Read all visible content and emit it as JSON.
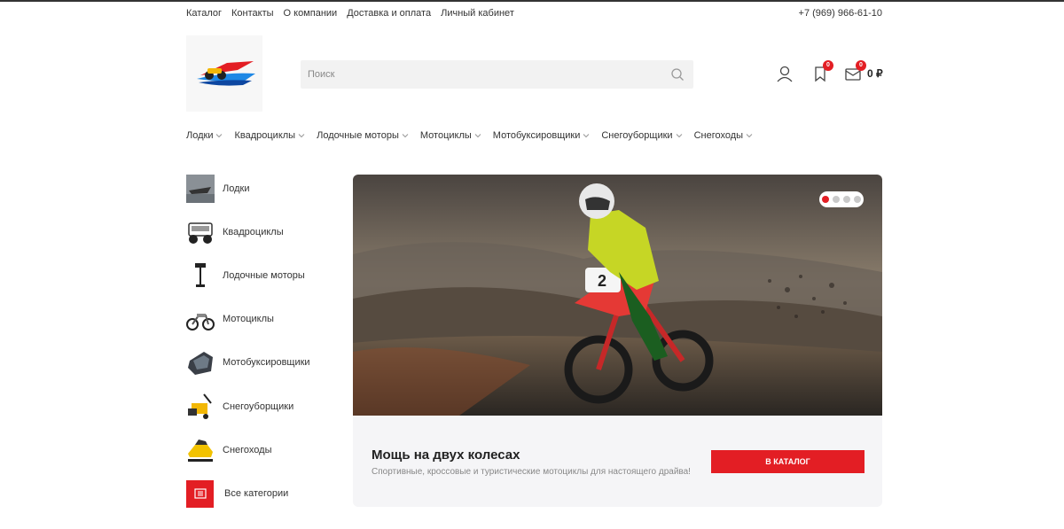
{
  "top_nav": [
    "Каталог",
    "Контакты",
    "О компании",
    "Доставка и оплата",
    "Личный кабинет"
  ],
  "phone": "+7 (969) 966-61-10",
  "search": {
    "placeholder": "Поиск"
  },
  "header": {
    "wishlist_count": "0",
    "cart_count": "0",
    "cart_total": "0 ₽"
  },
  "category_nav": [
    "Лодки",
    "Квадроциклы",
    "Лодочные моторы",
    "Мотоциклы",
    "Мотобуксировщики",
    "Снегоуборщики",
    "Снегоходы"
  ],
  "sidebar": {
    "items": [
      {
        "label": "Лодки",
        "icon": "boat-icon"
      },
      {
        "label": "Квадроциклы",
        "icon": "atv-icon"
      },
      {
        "label": "Лодочные моторы",
        "icon": "outboard-motor-icon"
      },
      {
        "label": "Мотоциклы",
        "icon": "motorcycle-icon"
      },
      {
        "label": "Мотобуксировщики",
        "icon": "motor-tug-icon"
      },
      {
        "label": "Снегоуборщики",
        "icon": "snowblower-icon"
      },
      {
        "label": "Снегоходы",
        "icon": "snowmobile-icon"
      }
    ],
    "all_label": "Все категории"
  },
  "slider": {
    "slides": 4,
    "active": 1
  },
  "promo": {
    "title": "Мощь на двух колесах",
    "subtitle": "Спортивные, кроссовые и туристические мотоциклы для настоящего драйва!",
    "button": "В КАТАЛОГ"
  },
  "colors": {
    "accent": "#e31e24",
    "text": "#222222",
    "muted": "#888888",
    "panel": "#f5f5f7"
  }
}
